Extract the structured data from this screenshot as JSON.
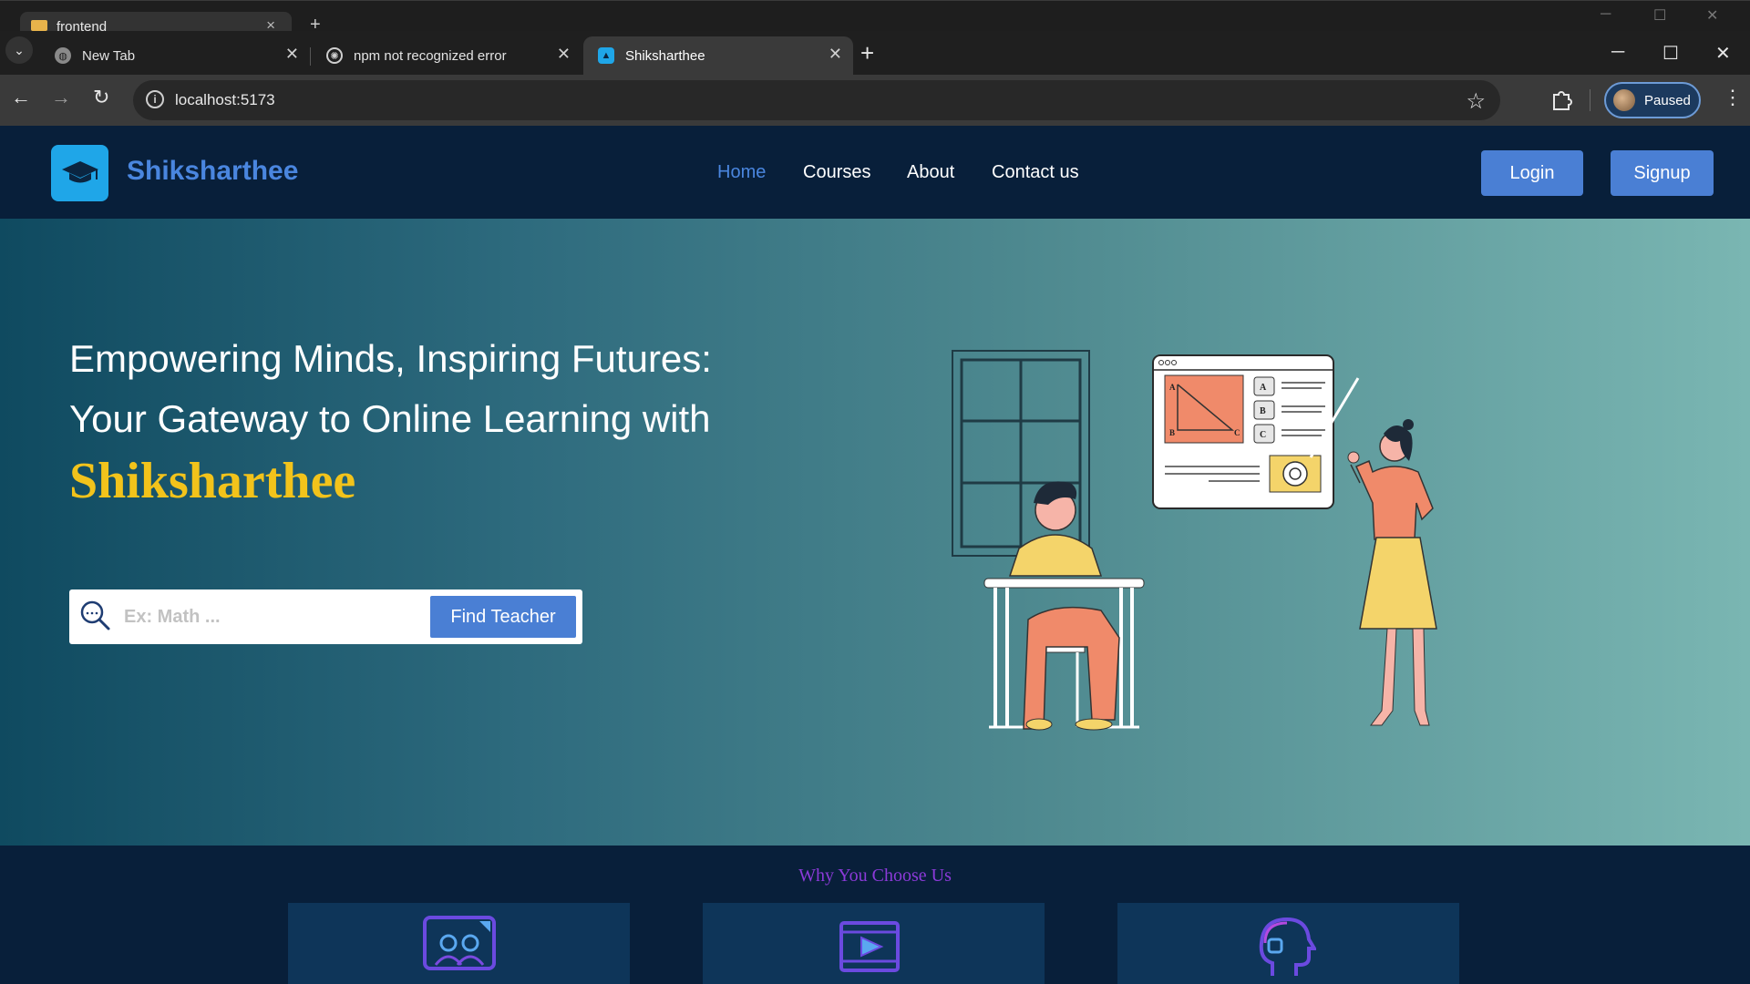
{
  "behind_window": {
    "tab_label": "frontend"
  },
  "browser": {
    "tabs": [
      {
        "label": "New Tab",
        "active": false
      },
      {
        "label": "npm not recognized error",
        "active": false
      },
      {
        "label": "Shiksharthee",
        "active": true
      }
    ],
    "address": "localhost:5173",
    "profile_status": "Paused"
  },
  "site": {
    "brand": "Shiksharthee",
    "nav": [
      {
        "label": "Home",
        "active": true
      },
      {
        "label": "Courses",
        "active": false
      },
      {
        "label": "About",
        "active": false
      },
      {
        "label": "Contact us",
        "active": false
      }
    ],
    "login_label": "Login",
    "signup_label": "Signup"
  },
  "hero": {
    "line1": "Empowering Minds, Inspiring Futures:",
    "line2": "Your Gateway to Online Learning with",
    "brand": "Shiksharthee",
    "search_placeholder": "Ex: Math ...",
    "search_value": "",
    "find_button": "Find Teacher",
    "board_labels": [
      "A",
      "B",
      "C"
    ]
  },
  "why": {
    "title": "Why You Choose Us"
  },
  "colors": {
    "accent": "#4a7fd4",
    "brand_yellow": "#f2c31b",
    "header_bg": "#081f3a",
    "why_title": "#8b3ad8"
  }
}
